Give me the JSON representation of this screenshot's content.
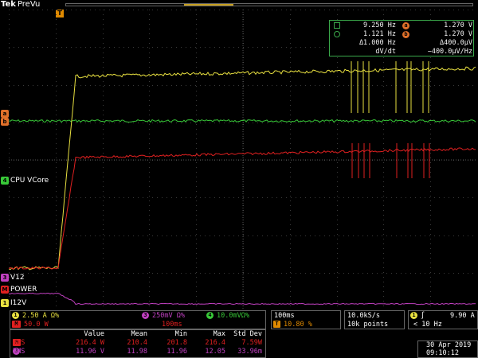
{
  "brand": "Tek",
  "mode": "PreVu",
  "trigger_position_label": "T",
  "cursor_readout": {
    "r1_left": "9.250 Hz",
    "r1_badge": "a",
    "r1_right": "1.270 V",
    "r2_left": "1.121 Hz",
    "r2_badge": "b",
    "r2_right": "1.270 V",
    "r3_left": "Δ1.000 Hz",
    "r3_right": "Δ400.0μV",
    "r4_left": "dV/dt",
    "r4_right": "−400.0μV/Hz"
  },
  "waveform_labels": {
    "cpu_vcore": "CPU VCore",
    "v12": "V12",
    "power": "POWER",
    "i12v": "I12V"
  },
  "marker_glyphs": {
    "a": "a",
    "b": "b",
    "ch4": "4",
    "ch3": "3",
    "m": "M",
    "ch1": "1"
  },
  "colors": {
    "ch1_yellow": "#e8e040",
    "ch2_green": "#38c838",
    "ch3_magenta": "#c040c0",
    "math_red": "#e02020",
    "cursor_orange": "#e0702a",
    "grid": "#3a3a3a"
  },
  "channels": {
    "ch1": {
      "num": "1",
      "scale": "2.50 A",
      "coupling": "Ω%"
    },
    "ch3": {
      "num": "3",
      "scale": "250mV",
      "coupling": "Ω%"
    },
    "ch4": {
      "num": "4",
      "scale": "10.0mV",
      "coupling": "Ω%"
    },
    "math": {
      "label": "M",
      "scale": "50.0 W",
      "time": "100ms"
    }
  },
  "horizontal": {
    "scale": "100ms",
    "trigger_badge": "T",
    "position": "10.80 %"
  },
  "acquisition": {
    "rate": "10.0kS/s",
    "points": "10k points"
  },
  "trigger": {
    "num": "1",
    "slope": "∫",
    "level": "9.90 A",
    "filter": "< 10 Hz"
  },
  "measurements": {
    "headers": [
      "Value",
      "Mean",
      "Min",
      "Max",
      "Std Dev"
    ],
    "rows": [
      {
        "badge": "M",
        "name": "RMS",
        "value": "216.4 W",
        "mean": "210.4",
        "min": "201.8",
        "max": "216.4",
        "std": "7.59W"
      },
      {
        "badge": "3",
        "name": "RMS",
        "value": "11.96 V",
        "mean": "11.98",
        "min": "11.96",
        "max": "12.05",
        "std": "33.96m"
      }
    ]
  },
  "datetime": {
    "date": "30 Apr 2019",
    "time": "09:10:12"
  }
}
